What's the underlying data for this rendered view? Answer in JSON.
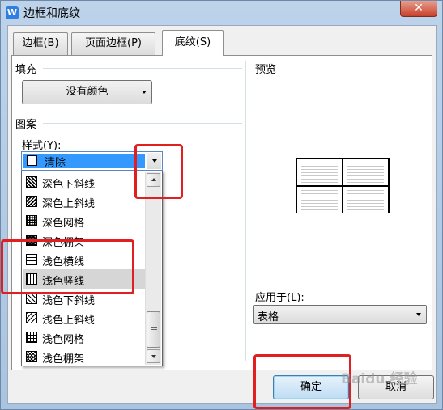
{
  "window": {
    "title": "边框和底纹",
    "app_icon": "W",
    "close_label": "✕"
  },
  "tabs": [
    {
      "label": "边框(B)"
    },
    {
      "label": "页面边框(P)"
    },
    {
      "label": "底纹(S)"
    }
  ],
  "fill": {
    "group_label": "填充",
    "color_value": "没有颜色"
  },
  "pattern": {
    "group_label": "图案",
    "style_label": "样式(Y):",
    "style_value": "清除",
    "items": [
      {
        "label": "深色下斜线",
        "pattern": "dark-down-diagonal"
      },
      {
        "label": "深色上斜线",
        "pattern": "dark-up-diagonal"
      },
      {
        "label": "深色网格",
        "pattern": "dark-grid"
      },
      {
        "label": "深色棚架",
        "pattern": "dark-trellis"
      },
      {
        "label": "浅色横线",
        "pattern": "light-horizontal"
      },
      {
        "label": "浅色竖线",
        "pattern": "light-vertical"
      },
      {
        "label": "浅色下斜线",
        "pattern": "light-down-diagonal"
      },
      {
        "label": "浅色上斜线",
        "pattern": "light-up-diagonal"
      },
      {
        "label": "浅色网格",
        "pattern": "light-grid"
      },
      {
        "label": "浅色棚架",
        "pattern": "light-trellis"
      }
    ],
    "selected_item": "浅色竖线"
  },
  "preview": {
    "label": "预览"
  },
  "apply_to": {
    "label": "应用于(L):",
    "value": "表格"
  },
  "buttons": {
    "ok": "确定",
    "cancel": "取消"
  },
  "watermark": "Baidu 经验",
  "colors": {
    "highlight": "#3399ff",
    "annotation_red": "#e02020",
    "title_bar": "#bcd3ea"
  }
}
